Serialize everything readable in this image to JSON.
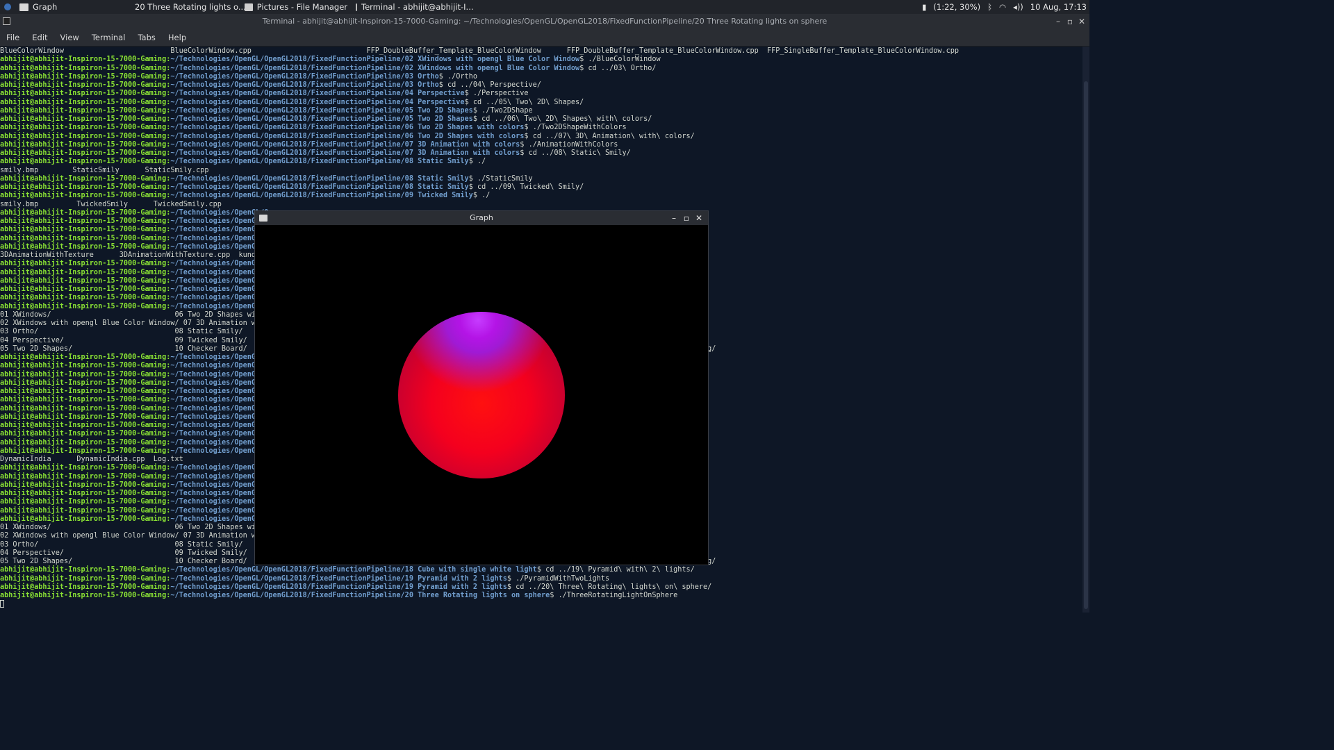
{
  "panel": {
    "tasks": [
      {
        "label": "Graph",
        "icon": "window-icon"
      },
      {
        "label": "20 Three Rotating lights o...",
        "icon": "folder-icon"
      },
      {
        "label": "Pictures - File Manager",
        "icon": "file-manager-icon"
      },
      {
        "label": "Terminal - abhijit@abhijit-I...",
        "icon": "terminal-icon"
      }
    ],
    "battery": "(1:22, 30%)",
    "clock": "10 Aug, 17:13"
  },
  "terminal": {
    "title": "Terminal - abhijit@abhijit-Inspiron-15-7000-Gaming: ~/Technologies/OpenGL/OpenGL2018/FixedFunctionPipeline/20 Three Rotating lights on sphere",
    "menu": [
      "File",
      "Edit",
      "View",
      "Terminal",
      "Tabs",
      "Help"
    ],
    "user": "abhijit@abhijit-Inspiron-15-7000-Gaming:",
    "lines": [
      {
        "t": "out",
        "text": "BlueColorWindow                         BlueColorWindow.cpp                           FFP_DoubleBuffer_Template_BlueColorWindow      FFP_DoubleBuffer_Template_BlueColorWindow.cpp  FFP_SingleBuffer_Template_BlueColorWindow.cpp"
      },
      {
        "t": "cmd",
        "path": "~/Technologies/OpenGL/OpenGL2018/FixedFunctionPipeline/02 XWindows with opengl Blue Color Window",
        "cmd": "$ ./BlueColorWindow"
      },
      {
        "t": "cmd",
        "path": "~/Technologies/OpenGL/OpenGL2018/FixedFunctionPipeline/02 XWindows with opengl Blue Color Window",
        "cmd": "$ cd ../03\\ Ortho/"
      },
      {
        "t": "cmd",
        "path": "~/Technologies/OpenGL/OpenGL2018/FixedFunctionPipeline/03 Ortho",
        "cmd": "$ ./Ortho"
      },
      {
        "t": "cmd",
        "path": "~/Technologies/OpenGL/OpenGL2018/FixedFunctionPipeline/03 Ortho",
        "cmd": "$ cd ../04\\ Perspective/"
      },
      {
        "t": "cmd",
        "path": "~/Technologies/OpenGL/OpenGL2018/FixedFunctionPipeline/04 Perspective",
        "cmd": "$ ./Perspective"
      },
      {
        "t": "cmd",
        "path": "~/Technologies/OpenGL/OpenGL2018/FixedFunctionPipeline/04 Perspective",
        "cmd": "$ cd ../05\\ Two\\ 2D\\ Shapes/"
      },
      {
        "t": "cmd",
        "path": "~/Technologies/OpenGL/OpenGL2018/FixedFunctionPipeline/05 Two 2D Shapes",
        "cmd": "$ ./Two2DShape"
      },
      {
        "t": "cmd",
        "path": "~/Technologies/OpenGL/OpenGL2018/FixedFunctionPipeline/05 Two 2D Shapes",
        "cmd": "$ cd ../06\\ Two\\ 2D\\ Shapes\\ with\\ colors/"
      },
      {
        "t": "cmd",
        "path": "~/Technologies/OpenGL/OpenGL2018/FixedFunctionPipeline/06 Two 2D Shapes with colors",
        "cmd": "$ ./Two2DShapeWithColors"
      },
      {
        "t": "cmd",
        "path": "~/Technologies/OpenGL/OpenGL2018/FixedFunctionPipeline/06 Two 2D Shapes with colors",
        "cmd": "$ cd ../07\\ 3D\\ Animation\\ with\\ colors/"
      },
      {
        "t": "cmd",
        "path": "~/Technologies/OpenGL/OpenGL2018/FixedFunctionPipeline/07 3D Animation with colors",
        "cmd": "$ ./AnimationWithColors"
      },
      {
        "t": "cmd",
        "path": "~/Technologies/OpenGL/OpenGL2018/FixedFunctionPipeline/07 3D Animation with colors",
        "cmd": "$ cd ../08\\ Static\\ Smily/"
      },
      {
        "t": "cmd",
        "path": "~/Technologies/OpenGL/OpenGL2018/FixedFunctionPipeline/08 Static Smily",
        "cmd": "$ ./"
      },
      {
        "t": "out",
        "text": "smily.bmp        StaticSmily      StaticSmily.cpp"
      },
      {
        "t": "cmd",
        "path": "~/Technologies/OpenGL/OpenGL2018/FixedFunctionPipeline/08 Static Smily",
        "cmd": "$ ./StaticSmily"
      },
      {
        "t": "cmd",
        "path": "~/Technologies/OpenGL/OpenGL2018/FixedFunctionPipeline/08 Static Smily",
        "cmd": "$ cd ../09\\ Twicked\\ Smily/"
      },
      {
        "t": "cmd",
        "path": "~/Technologies/OpenGL/OpenGL2018/FixedFunctionPipeline/09 Twicked Smily",
        "cmd": "$ ./"
      },
      {
        "t": "out",
        "text": "smily.bmp         TwickedSmily      TwickedSmily.cpp"
      },
      {
        "t": "cmd",
        "path": "~/Technologies/OpenGL/Op",
        "cmd": ""
      },
      {
        "t": "cmd",
        "path": "~/Technologies/OpenGL/Op",
        "cmd": ""
      },
      {
        "t": "cmd",
        "path": "~/Technologies/OpenGL/Op",
        "cmd": ""
      },
      {
        "t": "cmd",
        "path": "~/Technologies/OpenGL/Op",
        "cmd": ""
      },
      {
        "t": "cmd",
        "path": "~/Technologies/OpenGL/Op",
        "cmd": ""
      },
      {
        "t": "out",
        "text": "3DAnimationWithTexture      3DAnimationWithTexture.cpp  kundali."
      },
      {
        "t": "cmd",
        "path": "~/Technologies/OpenGL/Op",
        "cmd": ""
      },
      {
        "t": "cmd",
        "path": "~/Technologies/OpenGL/Op",
        "cmd": ""
      },
      {
        "t": "cmd",
        "path": "~/Technologies/OpenGL/Op",
        "cmd": ""
      },
      {
        "t": "cmd",
        "path": "~/Technologies/OpenGL/Op",
        "cmd": ""
      },
      {
        "t": "cmd",
        "path": "~/Technologies/OpenGL/Op",
        "cmd": ""
      },
      {
        "t": "cmd",
        "path": "~/Technologies/OpenGL/Op",
        "cmd": ""
      },
      {
        "t": "out",
        "text": "01 XWindows/                             06 Two 2D Shapes with                                                                                        Sphere Material/"
      },
      {
        "t": "out",
        "text": "02 XWindows with opengl Blue Color Window/ 07 3D Animation with                                                                                       t light/"
      },
      {
        "t": "out",
        "text": "03 Ortho/                                08 Static Smily/                                                                                             otic Arm/"
      },
      {
        "t": "out",
        "text": "04 Perspective/                          09 Twicked Smily/                                                                                            ar system/"
      },
      {
        "t": "out",
        "text": "05 Two 2D Shapes/                        10 Checker Board/                                                                                            oot model loading/"
      },
      {
        "t": "cmd",
        "path": "~/Technologies/OpenGL/Op",
        "cmd": ""
      },
      {
        "t": "cmd",
        "path": "~/Technologies/OpenGL/Op",
        "cmd": ""
      },
      {
        "t": "cmd",
        "path": "~/Technologies/OpenGL/Op",
        "cmd": ""
      },
      {
        "t": "cmd",
        "path": "~/Technologies/OpenGL/Op",
        "cmd": ""
      },
      {
        "t": "cmd",
        "path": "~/Technologies/OpenGL/Op",
        "cmd": ""
      },
      {
        "t": "cmd",
        "path": "~/Technologies/OpenGL/Op",
        "cmd": ""
      },
      {
        "t": "cmd",
        "path": "~/Technologies/OpenGL/Op",
        "cmd": ""
      },
      {
        "t": "cmd",
        "path": "~/Technologies/OpenGL/Op",
        "cmd": ""
      },
      {
        "t": "cmd",
        "path": "~/Technologies/OpenGL/Op",
        "cmd": ""
      },
      {
        "t": "cmd",
        "path": "~/Technologies/OpenGL/Op",
        "cmd": ""
      },
      {
        "t": "cmd",
        "path": "~/Technologies/OpenGL/Op",
        "cmd": ""
      },
      {
        "t": "cmd",
        "path": "~/Technologies/OpenGL/Op",
        "cmd": ""
      },
      {
        "t": "out",
        "text": "DynamicIndia      DynamicIndia.cpp  Log.txt"
      },
      {
        "t": "cmd",
        "path": "~/Technologies/OpenGL/Op",
        "cmd": ""
      },
      {
        "t": "cmd",
        "path": "~/Technologies/OpenGL/Op",
        "cmd": ""
      },
      {
        "t": "cmd",
        "path": "~/Technologies/OpenGL/Op",
        "cmd": ""
      },
      {
        "t": "cmd",
        "path": "~/Technologies/OpenGL/Op",
        "cmd": ""
      },
      {
        "t": "cmd",
        "path": "~/Technologies/OpenGL/Op",
        "cmd": ""
      },
      {
        "t": "cmd",
        "path": "~/Technologies/OpenGL/Op",
        "cmd": ""
      },
      {
        "t": "cmd",
        "path": "~/Technologies/OpenGL/Op",
        "cmd": ""
      },
      {
        "t": "out",
        "text": "01 XWindows/                             06 Two 2D Shapes with                                                                                        Sphere Material/"
      },
      {
        "t": "out",
        "text": "02 XWindows with opengl Blue Color Window/ 07 3D Animation with                                                                                       t light/"
      },
      {
        "t": "out",
        "text": "03 Ortho/                                08 Static Smily/                                                                                             otic Arm/"
      },
      {
        "t": "out",
        "text": "04 Perspective/                          09 Twicked Smily/                                                                                            ar system/"
      },
      {
        "t": "out",
        "text": "05 Two 2D Shapes/                        10 Checker Board/                                                                                            oot model loading/"
      },
      {
        "t": "cmd",
        "path": "~/Technologies/OpenGL/OpenGL2018/FixedFunctionPipeline/18 Cube with single white light",
        "cmd": "$ cd ../19\\ Pyramid\\ with\\ 2\\ lights/"
      },
      {
        "t": "cmd",
        "path": "~/Technologies/OpenGL/OpenGL2018/FixedFunctionPipeline/19 Pyramid with 2 lights",
        "cmd": "$ ./PyramidWithTwoLights"
      },
      {
        "t": "cmd",
        "path": "~/Technologies/OpenGL/OpenGL2018/FixedFunctionPipeline/19 Pyramid with 2 lights",
        "cmd": "$ cd ../20\\ Three\\ Rotating\\ lights\\ on\\ sphere/"
      },
      {
        "t": "cmd",
        "path": "~/Technologies/OpenGL/OpenGL2018/FixedFunctionPipeline/20 Three Rotating lights on sphere",
        "cmd": "$ ./ThreeRotatingLightOnSphere"
      }
    ]
  },
  "graph": {
    "title": "Graph"
  },
  "colors": {
    "user": "#8ae234",
    "path": "#729fcf",
    "background": "#0e1726",
    "sphere_top": "#a020e0",
    "sphere_main": "#ff0020"
  }
}
